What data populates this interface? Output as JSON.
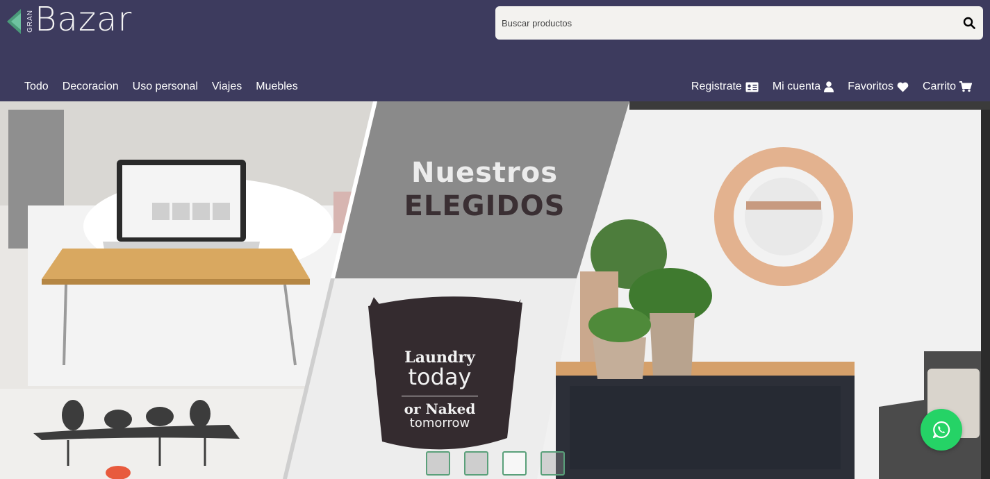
{
  "brand": {
    "name": "Bazar",
    "prefix": "GRAN"
  },
  "search": {
    "placeholder": "Buscar productos",
    "icon": "search-icon"
  },
  "nav": {
    "left": [
      {
        "label": "Todo"
      },
      {
        "label": "Decoracion"
      },
      {
        "label": "Uso personal"
      },
      {
        "label": "Viajes"
      },
      {
        "label": "Muebles"
      }
    ],
    "right": [
      {
        "label": "Registrate",
        "icon": "id-card-icon"
      },
      {
        "label": "Mi cuenta",
        "icon": "user-icon"
      },
      {
        "label": "Favoritos",
        "icon": "heart-icon"
      },
      {
        "label": "Carrito",
        "icon": "cart-icon"
      }
    ]
  },
  "hero": {
    "headline_line1": "Nuestros",
    "headline_line2": "ELEGIDOS",
    "bag_line1": "Laundry",
    "bag_line2": "today",
    "bag_line3": "or Naked",
    "bag_line4": "tomorrow",
    "slides": 4
  },
  "colors": {
    "header": "#3d3b5e",
    "accent_green": "#25d366"
  }
}
